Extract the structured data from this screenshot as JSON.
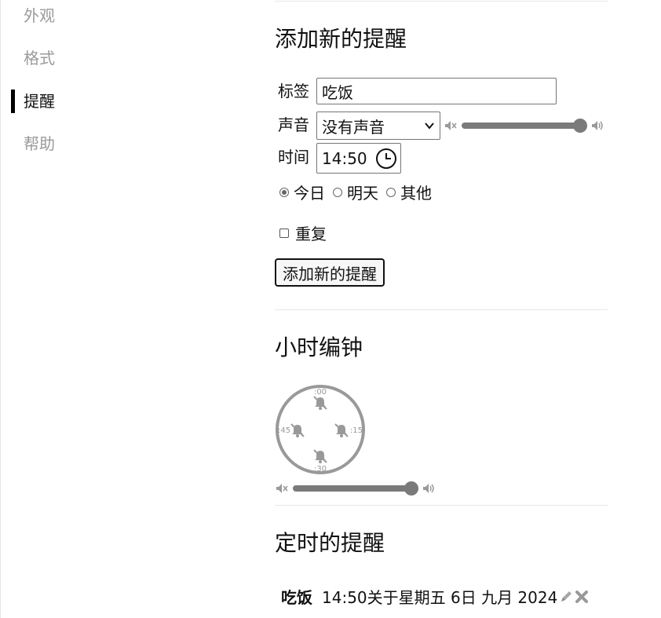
{
  "sidebar": {
    "items": [
      {
        "label": "外观",
        "active": false
      },
      {
        "label": "格式",
        "active": false
      },
      {
        "label": "提醒",
        "active": true
      },
      {
        "label": "帮助",
        "active": false
      }
    ]
  },
  "add_reminder": {
    "heading": "添加新的提醒",
    "label_field": {
      "label": "标签",
      "value": "吃饭"
    },
    "sound_field": {
      "label": "声音",
      "selected": "没有声音",
      "volume_percent": 100
    },
    "time_field": {
      "label": "时间",
      "value": "14:50"
    },
    "day_options": [
      {
        "label": "今日",
        "checked": true
      },
      {
        "label": "明天",
        "checked": false
      },
      {
        "label": "其他",
        "checked": false
      }
    ],
    "repeat": {
      "label": "重复",
      "checked": false
    },
    "submit_label": "添加新的提醒"
  },
  "hourly_chime": {
    "heading": "小时编钟",
    "marks": [
      ":00",
      ":15",
      ":30",
      ":45"
    ],
    "volume_percent": 100
  },
  "scheduled": {
    "heading": "定时的提醒",
    "items": [
      {
        "title": "吃饭",
        "detail": "14:50关于星期五 6日 九月 2024"
      }
    ]
  },
  "colors": {
    "muted": "#9a9a9a",
    "slider": "#7a7a7a",
    "text": "#111111"
  },
  "icons": {
    "mute": "speaker-mute-icon",
    "loud": "speaker-loud-icon",
    "clock": "clock-icon",
    "edit": "pencil-icon",
    "delete": "cross-icon",
    "bell_off": "bell-off-icon"
  }
}
